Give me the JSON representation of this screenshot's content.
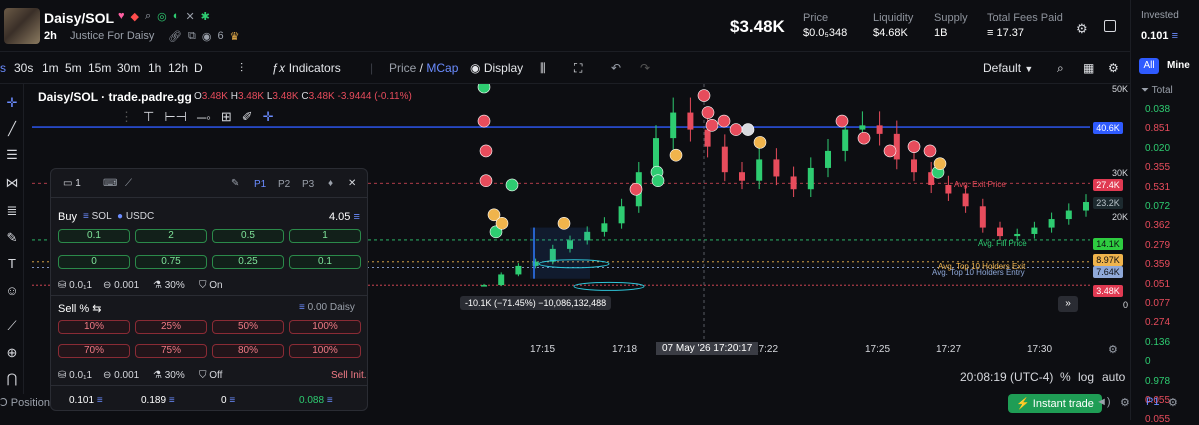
{
  "token": {
    "name": "Daisy/SOL",
    "age": "2h",
    "description": "Justice For Daisy",
    "holders_count": "6"
  },
  "header": {
    "price_big": "$3.48K",
    "stats": [
      {
        "label": "Price",
        "value": "$0.0₅348"
      },
      {
        "label": "Liquidity",
        "value": "$4.68K"
      },
      {
        "label": "Supply",
        "value": "1B"
      },
      {
        "label": "Total Fees Paid",
        "value": "17.37"
      }
    ]
  },
  "right_panel": {
    "invested_label": "Invested",
    "invested_value": "0.101",
    "tabs": [
      "All",
      "Mine"
    ],
    "total_label": "Total",
    "values": [
      {
        "text": "0.038",
        "color": "#2ecc71"
      },
      {
        "text": "0.851",
        "color": "#e74c5c"
      },
      {
        "text": "0.020",
        "color": "#2ecc71"
      },
      {
        "text": "0.355",
        "color": "#e74c5c"
      },
      {
        "text": "0.531",
        "color": "#e74c5c"
      },
      {
        "text": "0.072",
        "color": "#2ecc71"
      },
      {
        "text": "0.362",
        "color": "#e74c5c"
      },
      {
        "text": "0.279",
        "color": "#e74c5c"
      },
      {
        "text": "0.359",
        "color": "#e74c5c"
      },
      {
        "text": "0.051",
        "color": "#e74c5c"
      },
      {
        "text": "0.077",
        "color": "#e74c5c"
      },
      {
        "text": "0.274",
        "color": "#e74c5c"
      },
      {
        "text": "0.136",
        "color": "#2ecc71"
      },
      {
        "text": "0",
        "color": "#2ecc71"
      },
      {
        "text": "0.978",
        "color": "#2ecc71"
      },
      {
        "text": "0.055",
        "color": "#e74c5c"
      },
      {
        "text": "0.055",
        "color": "#e74c5c"
      }
    ]
  },
  "toolbar": {
    "timeframes": [
      "s",
      "30s",
      "1m",
      "5m",
      "15m",
      "30m",
      "1h",
      "12h",
      "D"
    ],
    "indicators": "Indicators",
    "price_label": "Price",
    "mcap_label": "MCap",
    "display": "Display",
    "layout": "Default"
  },
  "legend": {
    "title": "Daisy/SOL · trade.padre.gg",
    "o_label": "O",
    "o_value": "3.48K",
    "h_label": "H",
    "h_value": "3.48K",
    "l_label": "L",
    "l_value": "3.48K",
    "c_label": "C",
    "c_value": "3.48K",
    "change": "-3.9444 (-0.11%)"
  },
  "chart_lines": {
    "exit_price": "Avg. Exit Price",
    "fill_price": "Avg. Fill Price",
    "top10_exit": "Avg. Top 10 Holders Exit",
    "top10_entry": "Avg. Top 10 Holders Entry",
    "measure": "-10.1K (−71.45%) −10,086,132,488"
  },
  "y_axis": {
    "labels": [
      "50K",
      "30K",
      "20K",
      "0"
    ],
    "tags": [
      {
        "text": "40.6K",
        "bg": "#2f5bff",
        "fg": "#ffffff"
      },
      {
        "text": "27.4K",
        "bg": "#e03a52",
        "fg": "#ffffff"
      },
      {
        "text": "23.2K",
        "bg": "#1d2a2f",
        "fg": "#b8c2c8"
      },
      {
        "text": "14.1K",
        "bg": "#2ecc40",
        "fg": "#0d0e12"
      },
      {
        "text": "8.97K",
        "bg": "#f0b44c",
        "fg": "#0d0e12"
      },
      {
        "text": "7.64K",
        "bg": "#8fa8d8",
        "fg": "#0d0e12"
      },
      {
        "text": "3.48K",
        "bg": "#e03a52",
        "fg": "#ffffff"
      }
    ]
  },
  "x_axis": {
    "ticks": [
      "17:15",
      "17:18",
      "17:22",
      "17:25",
      "17:27",
      "17:30"
    ],
    "cursor_label": "07 May '26   17:20:17"
  },
  "status": {
    "clock": "20:08:19 (UTC-4)",
    "percent": "%",
    "log": "log",
    "auto": "auto",
    "positions": "Positions",
    "instant_trade": "Instant trade",
    "p1": "P1"
  },
  "trade_panel": {
    "count": "1",
    "presets": [
      "P1",
      "P2",
      "P3"
    ],
    "buy_label": "Buy",
    "sol_label": "SOL",
    "usdc_label": "USDC",
    "buy_balance": "4.05",
    "buy_amounts": [
      "0.1",
      "2",
      "0.5",
      "1",
      "0",
      "0.75",
      "0.25",
      "0.1"
    ],
    "buy_settings": {
      "slippage": "0.0₁1",
      "priority": "0.001",
      "percent": "30%",
      "mev": "On"
    },
    "sell_label": "Sell %",
    "sell_balance": "0.00 Daisy",
    "sell_amounts": [
      "10%",
      "25%",
      "50%",
      "100%",
      "70%",
      "75%",
      "80%",
      "100%"
    ],
    "sell_settings": {
      "slippage": "0.0₁1",
      "priority": "0.001",
      "percent": "30%",
      "mev": "Off"
    },
    "sell_init": "Sell Init.",
    "footer": [
      "0.101",
      "0.189",
      "0",
      "0.088"
    ]
  },
  "chart_data": {
    "type": "candlestick",
    "x_ticks": [
      "17:15",
      "17:18",
      "17:22",
      "17:25",
      "17:27",
      "17:30"
    ],
    "y_ticks": [
      "50K",
      "30K",
      "20K",
      "0"
    ],
    "close_series_mcap_k": [
      3.5,
      6,
      8,
      9,
      12,
      14,
      16,
      18,
      22,
      30,
      38,
      44,
      40,
      36,
      30,
      28,
      33,
      29,
      26,
      31,
      35,
      40,
      41,
      39,
      33,
      30,
      27,
      25,
      22,
      17,
      15,
      15.5,
      17,
      19,
      21,
      23
    ],
    "reference_lines": [
      {
        "label": "40.6K",
        "type": "horizontal"
      },
      {
        "label": "Avg. Exit Price",
        "value": "27.4K"
      },
      {
        "label": "Avg. Fill Price",
        "value": "14.1K"
      },
      {
        "label": "Avg. Top 10 Holders Exit",
        "value": "8.97K"
      },
      {
        "label": "Avg. Top 10 Holders Entry",
        "value": "7.64K"
      },
      {
        "label": "current",
        "value": "3.48K"
      }
    ]
  },
  "colors": {
    "up": "#2ecc71",
    "down": "#e74c5c",
    "accent": "#2f5bff",
    "panel": "#16171c"
  }
}
